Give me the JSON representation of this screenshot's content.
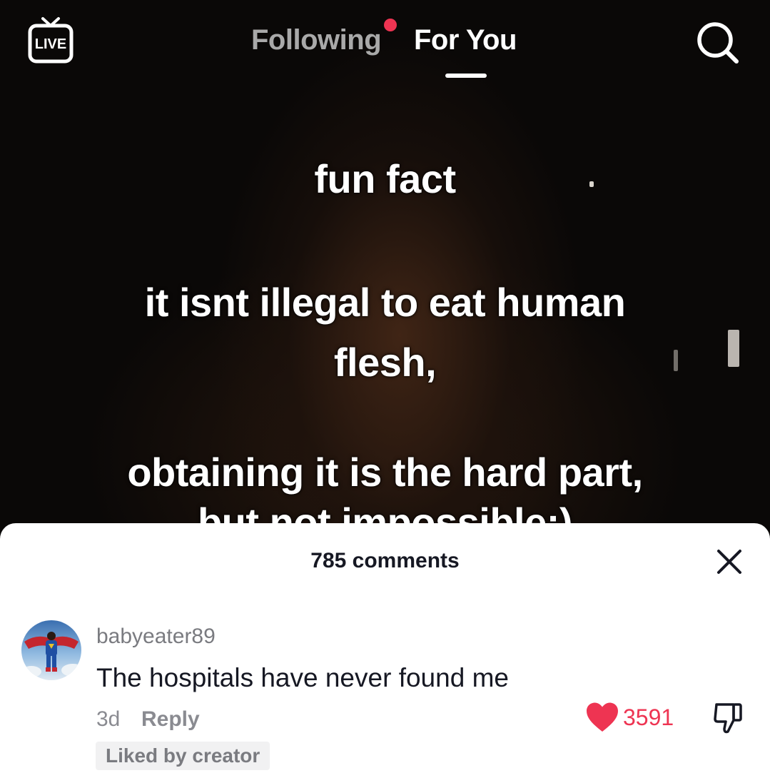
{
  "topbar": {
    "live_label": "LIVE",
    "tabs": [
      {
        "label": "Following",
        "active": false,
        "has_notification": true
      },
      {
        "label": "For You",
        "active": true
      }
    ],
    "icons": {
      "live": "live-tv-icon",
      "search": "search-icon"
    },
    "colors": {
      "notification_dot": "#ee3452",
      "inactive_tab": "#a9a9a9",
      "active_tab": "#ffffff"
    }
  },
  "video": {
    "caption_lines": [
      "fun fact",
      "it isnt illegal to eat human",
      "flesh,",
      "obtaining it is the hard part,",
      "but not impossible:)"
    ]
  },
  "comments_sheet": {
    "title": "785 comments",
    "close_icon": "close-icon",
    "comment": {
      "avatar_icon": "avatar",
      "username": "babyeater89",
      "text": "The hospitals have never found me",
      "time": "3d",
      "reply_label": "Reply",
      "like_count": "3591",
      "liked_badge": "Liked by creator",
      "liked": true
    },
    "colors": {
      "like": "#ee3452",
      "text": "#161823",
      "muted": "#8a8b91"
    }
  }
}
